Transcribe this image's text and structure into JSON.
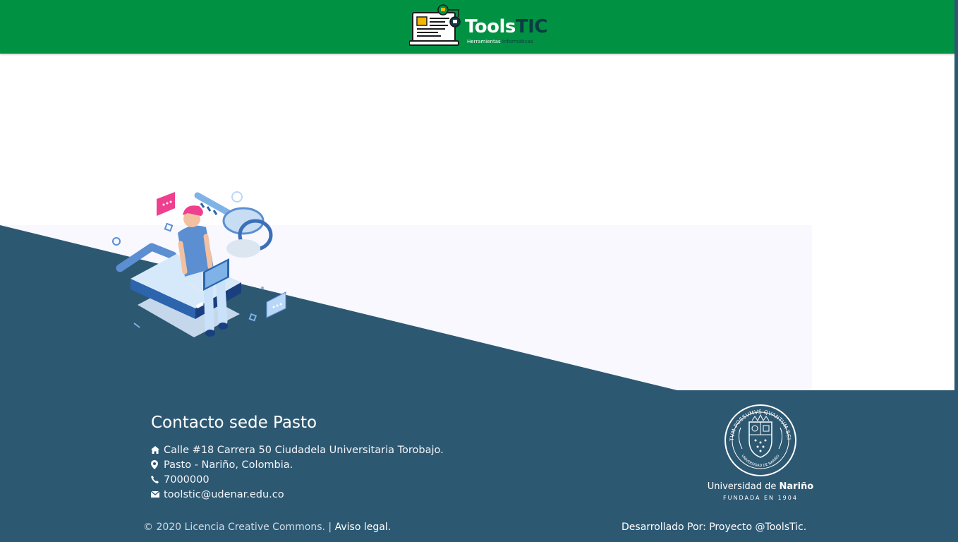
{
  "header": {
    "logo_main": "Tools",
    "logo_accent": "TIC",
    "logo_sub_1": "Herramientas",
    "logo_sub_2": "Informáticas"
  },
  "contact": {
    "title": "Contacto sede Pasto",
    "address": "Calle #18 Carrera 50 Ciudadela Universitaria Torobajo.",
    "city": "Pasto - Nariño, Colombia.",
    "phone": "7000000",
    "email": "toolstic@udenar.edu.co"
  },
  "footer": {
    "copyright": "© 2020 Licencia Creative Commons. |",
    "legal_link": "Aviso legal.",
    "developed_by": "Desarrollado Por: Proyecto @ToolsTic."
  },
  "university": {
    "name_prefix": "Universidad de",
    "name_bold": "Nariño",
    "founded": "FUNDADA EN 1904",
    "seal_motto": "TANTVM POSSVMVS QVANTVM SCIMVS",
    "seal_inner": "UNIVERSIDAD DE NARIÑO"
  },
  "colors": {
    "header_green": "#009143",
    "footer_blue": "#2d5872",
    "panel_tint": "#f8f8fe"
  },
  "icons": [
    "laptop-logo-icon",
    "home-icon",
    "location-pin-icon",
    "phone-icon",
    "email-icon",
    "university-seal-icon"
  ]
}
